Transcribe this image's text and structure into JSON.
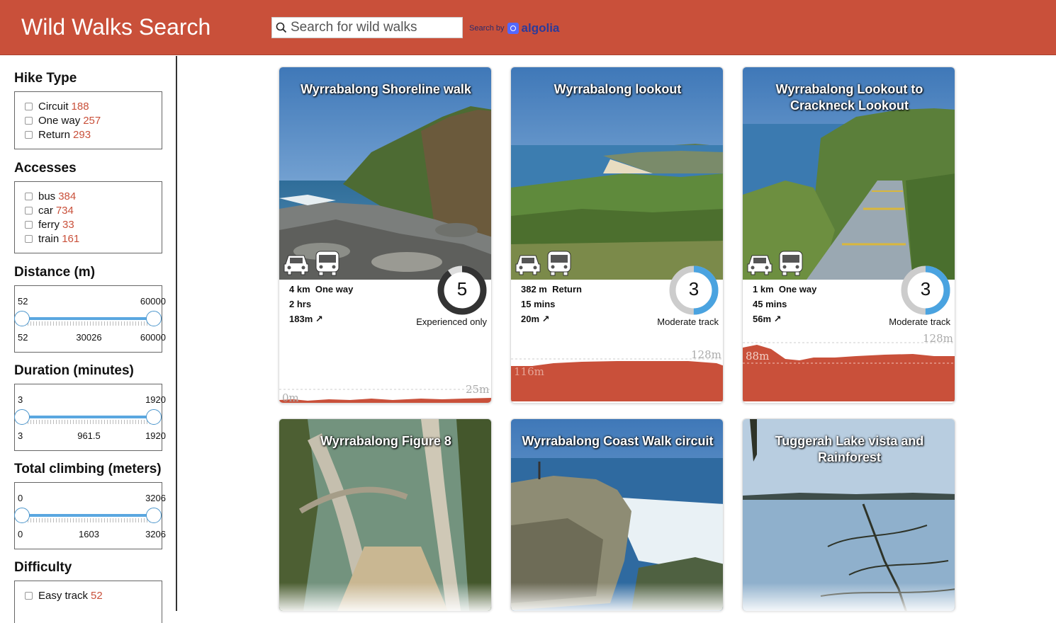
{
  "header": {
    "title": "Wild Walks Search",
    "search_placeholder": "Search for wild walks",
    "search_by": "Search by",
    "search_brand": "algolia",
    "brand_color": "#c9503a"
  },
  "sidebar": {
    "hike_type": {
      "title": "Hike Type",
      "items": [
        {
          "label": "Circuit",
          "count": "188"
        },
        {
          "label": "One way",
          "count": "257"
        },
        {
          "label": "Return",
          "count": "293"
        }
      ]
    },
    "accesses": {
      "title": "Accesses",
      "items": [
        {
          "label": "bus",
          "count": "384"
        },
        {
          "label": "car",
          "count": "734"
        },
        {
          "label": "ferry",
          "count": "33"
        },
        {
          "label": "train",
          "count": "161"
        }
      ]
    },
    "distance": {
      "title": "Distance (m)",
      "min": "52",
      "max": "60000",
      "mid": "30026"
    },
    "duration": {
      "title": "Duration (minutes)",
      "min": "3",
      "max": "1920",
      "mid": "961.5"
    },
    "climbing": {
      "title": "Total climbing (meters)",
      "min": "0",
      "max": "3206",
      "mid": "1603"
    },
    "difficulty": {
      "title": "Difficulty",
      "items": [
        {
          "label": "Easy track",
          "count": "52"
        }
      ]
    }
  },
  "cards": [
    {
      "title": "Wyrrabalong Shoreline walk",
      "distance": "4 km",
      "type": "One way",
      "duration": "2 hrs",
      "climb": "183m",
      "grade": "5",
      "grade_fraction": 0.9,
      "difficulty": "Experienced only",
      "elev_max": "25m",
      "elev_min": "0m",
      "transport": [
        "car-icon",
        "bus-icon"
      ]
    },
    {
      "title": "Wyrrabalong lookout",
      "distance": "382 m",
      "type": "Return",
      "duration": "15 mins",
      "climb": "20m",
      "grade": "3",
      "grade_fraction": 0.5,
      "difficulty": "Moderate track",
      "elev_max": "128m",
      "elev_min": "116m",
      "transport": [
        "car-icon",
        "bus-icon"
      ]
    },
    {
      "title": "Wyrrabalong Lookout to Crackneck Lookout",
      "distance": "1 km",
      "type": "One way",
      "duration": "45 mins",
      "climb": "56m",
      "grade": "3",
      "grade_fraction": 0.5,
      "difficulty": "Moderate track",
      "elev_max": "128m",
      "elev_min": "88m",
      "transport": [
        "car-icon",
        "bus-icon"
      ]
    },
    {
      "title": "Wyrrabalong Figure 8"
    },
    {
      "title": "Wyrrabalong Coast Walk circuit"
    },
    {
      "title": "Tuggerah Lake vista and Rainforest"
    }
  ]
}
